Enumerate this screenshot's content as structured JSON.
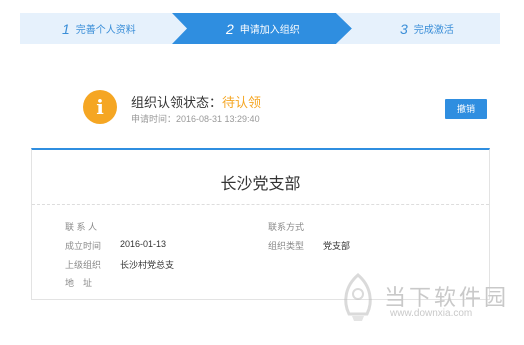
{
  "stepper": {
    "steps": [
      {
        "number": "1",
        "label": "完善个人资料",
        "state": "done"
      },
      {
        "number": "2",
        "label": "申请加入组织",
        "state": "active"
      },
      {
        "number": "3",
        "label": "完成激活",
        "state": "pending"
      }
    ],
    "colors": {
      "inactive_fill": "#e6f1fc",
      "active_fill": "#2f8ee0",
      "inactive_text": "#3a8ed8"
    }
  },
  "status": {
    "icon": "info-icon",
    "label": "组织认领状态：",
    "value": "待认领",
    "apply_time": "申请时间：2016-08-31 13:29:40",
    "value_color": "#f5a623",
    "revoke_label": "撤销"
  },
  "org": {
    "name": "长沙党支部",
    "fields": {
      "contact_label": "联 系 人",
      "contact_value": "",
      "contact_method_label": "联系方式",
      "contact_method_value": "",
      "established_label": "成立时间",
      "established_value": "2016-01-13",
      "type_label": "组织类型",
      "type_value": "党支部",
      "parent_label": "上级组织",
      "parent_value": "长沙村党总支",
      "address_label": "地　址",
      "address_value": ""
    }
  },
  "watermark": {
    "title": "当下软件园",
    "url": "www.downxia.com",
    "icon": "downxia-logo-icon"
  }
}
